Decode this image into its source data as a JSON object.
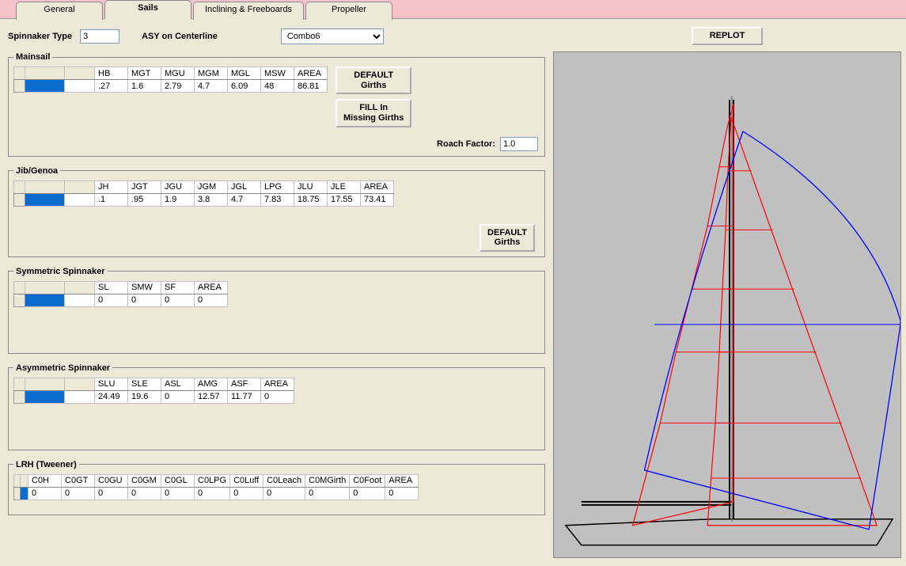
{
  "tabs": [
    "General",
    "Sails",
    "Inclining & Freeboards",
    "Propeller"
  ],
  "active_tab": 1,
  "spinnaker_type_label": "Spinnaker Type",
  "spinnaker_type_value": "3",
  "asy_label": "ASY on Centerline",
  "combo_value": "Combo6",
  "replot_label": "REPLOT",
  "mainsail": {
    "title": "Mainsail",
    "headers": [
      "HB",
      "MGT",
      "MGU",
      "MGM",
      "MGL",
      "MSW",
      "AREA"
    ],
    "row": [
      ".27",
      "1.6",
      "2.79",
      "4.7",
      "6.09",
      "48",
      "86.81"
    ],
    "default_btn": "DEFAULT\nGirths",
    "fill_btn": "FILL In\nMissing Girths",
    "roach_label": "Roach Factor:",
    "roach_value": "1.0"
  },
  "jib": {
    "title": "Jib/Genoa",
    "headers": [
      "JH",
      "JGT",
      "JGU",
      "JGM",
      "JGL",
      "LPG",
      "JLU",
      "JLE",
      "AREA"
    ],
    "row": [
      ".1",
      ".95",
      "1.9",
      "3.8",
      "4.7",
      "7.83",
      "18.75",
      "17.55",
      "73.41"
    ],
    "default_btn": "DEFAULT\nGirths"
  },
  "sym": {
    "title": "Symmetric Spinnaker",
    "headers": [
      "SL",
      "SMW",
      "SF",
      "AREA"
    ],
    "row": [
      "0",
      "0",
      "0",
      "0"
    ]
  },
  "asym": {
    "title": "Asymmetric Spinnaker",
    "headers": [
      "SLU",
      "SLE",
      "ASL",
      "AMG",
      "ASF",
      "AREA"
    ],
    "row": [
      "24.49",
      "19.6",
      "0",
      "12.57",
      "11.77",
      "0"
    ]
  },
  "lrh": {
    "title": "LRH (Tweener)",
    "headers": [
      "C0H",
      "C0GT",
      "C0GU",
      "C0GM",
      "C0GL",
      "C0LPG",
      "C0Luff",
      "C0Leach",
      "C0MGirth",
      "C0Foot",
      "AREA"
    ],
    "row": [
      "0",
      "0",
      "0",
      "0",
      "0",
      "0",
      "0",
      "0",
      "0",
      "0",
      "0"
    ]
  }
}
